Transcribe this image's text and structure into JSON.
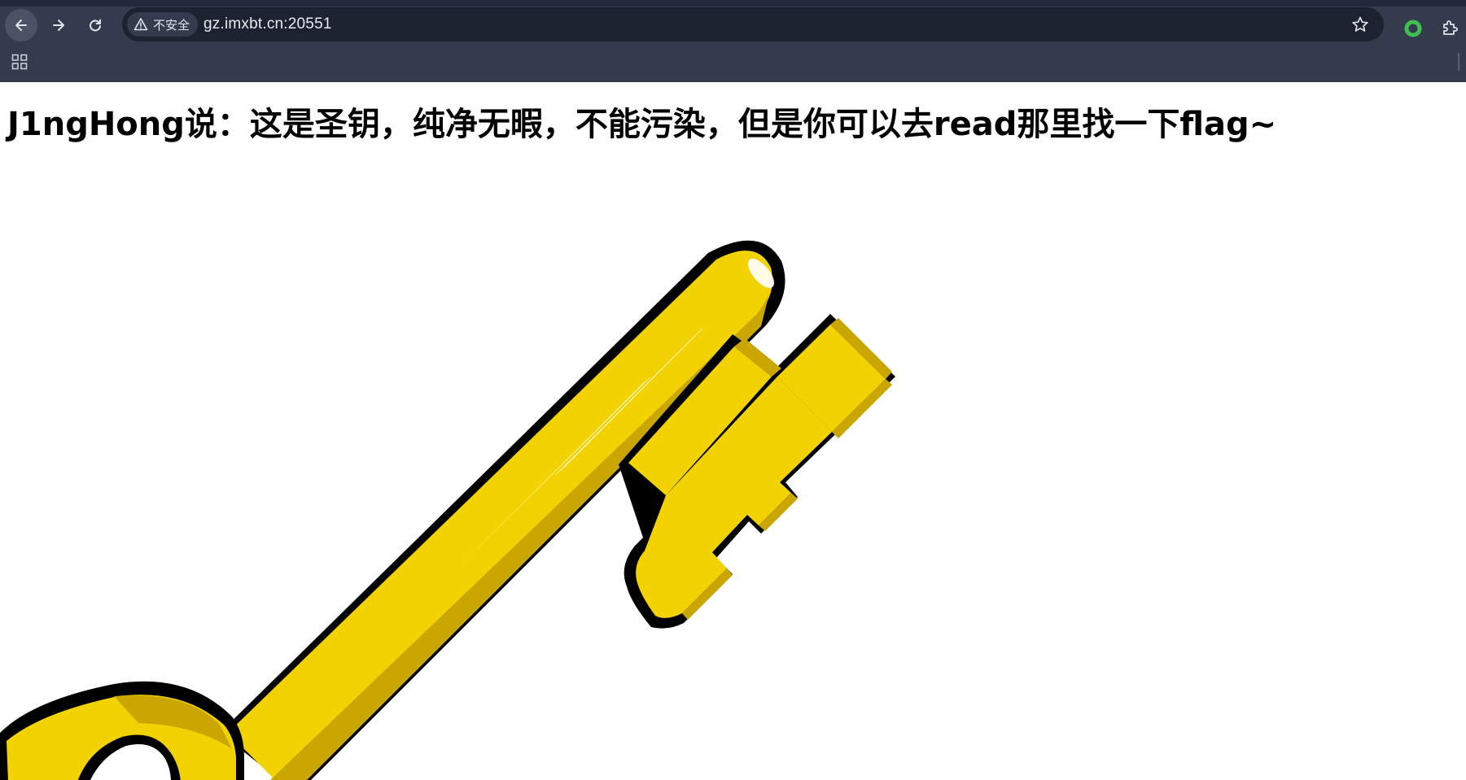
{
  "browser": {
    "security_label": "不安全",
    "url": "gz.imxbt.cn:20551",
    "icons": {
      "back": "arrow-left-icon",
      "forward": "arrow-right-icon",
      "reload": "reload-icon",
      "security": "warning-triangle-icon",
      "bookmark": "star-icon",
      "extension_status": "ring-icon",
      "extensions": "puzzle-icon",
      "apps": "apps-grid-icon"
    }
  },
  "page": {
    "heading": "J1ngHong说：这是圣钥，纯净无暇，不能污染，但是你可以去read那里找一下flag~",
    "image": {
      "subject": "golden key illustration",
      "colors": {
        "gold": "#f2d201",
        "gold_shadow": "#c9a700",
        "outline": "#000000"
      }
    }
  },
  "colors": {
    "chrome_background": "#343b4d",
    "omnibox_background": "#1d2230",
    "status_ring": "#3fbf4f",
    "page_background": "#ffffff",
    "heading_text": "#000000"
  }
}
